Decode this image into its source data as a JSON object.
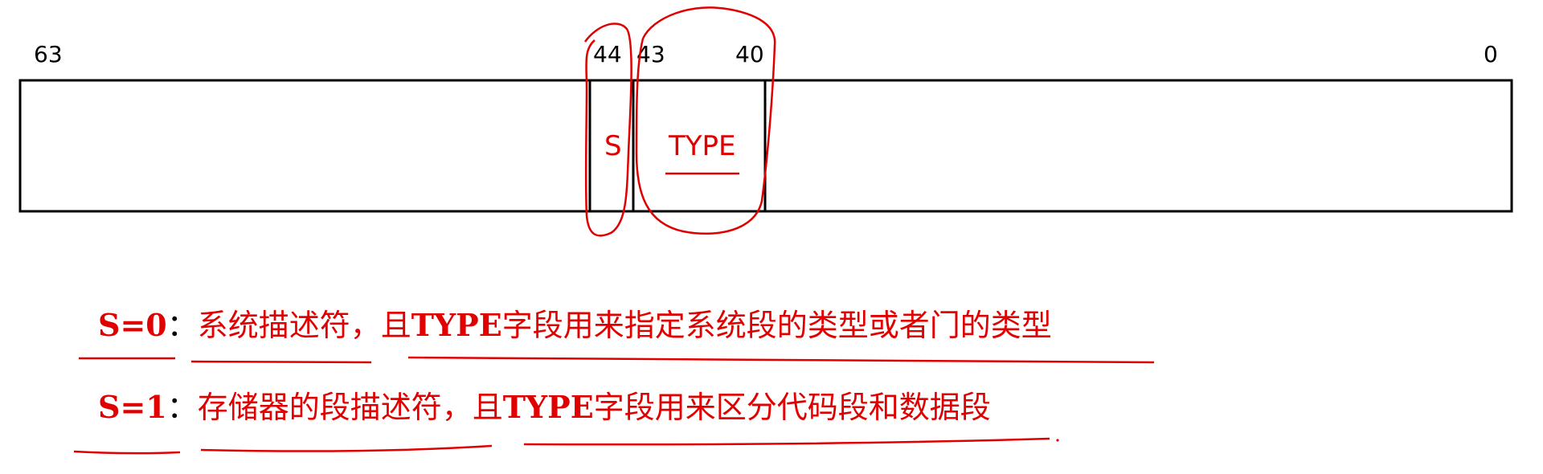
{
  "diagram": {
    "bits": {
      "b63": "63",
      "b44": "44",
      "b43": "43",
      "b40": "40",
      "b0": "0"
    },
    "fields": {
      "s": "S",
      "type": "TYPE"
    }
  },
  "notes": [
    {
      "key": "S=0",
      "colon": "：",
      "p1": "系统描述符，且",
      "em": "TYPE",
      "p2": "字段用来指定系统段的类型或者门的类型"
    },
    {
      "key": "S=1",
      "colon": "：",
      "p1": "存储器的段描述符，且",
      "em": "TYPE",
      "p2": "字段用来区分代码段和数据段"
    }
  ],
  "colors": {
    "ink": "#000000",
    "annotation": "#e00000"
  }
}
